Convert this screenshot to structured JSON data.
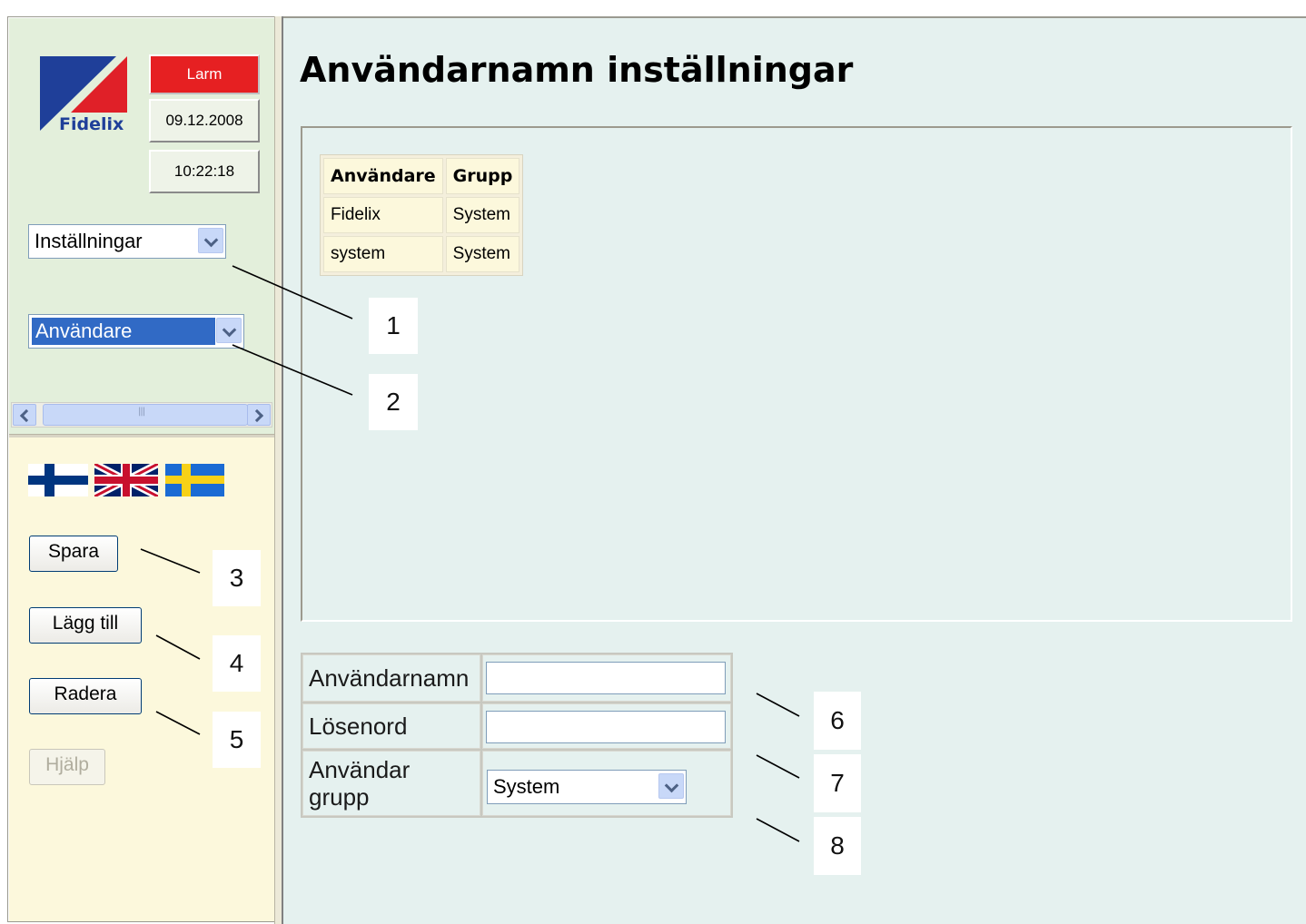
{
  "header": {
    "alarm_label": "Larm",
    "date": "09.12.2008",
    "time": "10:22:18"
  },
  "logo": {
    "text": "Fidelix",
    "colors": {
      "blue": "#1f3f99",
      "red": "#e02028"
    }
  },
  "nav": {
    "menu_select": "Inställningar",
    "submenu_select": "Användare"
  },
  "languages": [
    "finnish-flag",
    "uk-flag",
    "swedish-flag"
  ],
  "actions": {
    "save": "Spara",
    "add": "Lägg till",
    "delete": "Radera",
    "help": "Hjälp"
  },
  "page": {
    "title": "Användarnamn inställningar"
  },
  "users_table": {
    "headers": [
      "Användare",
      "Grupp"
    ],
    "rows": [
      [
        "Fidelix",
        "System"
      ],
      [
        "system",
        "System"
      ]
    ]
  },
  "form": {
    "username_label": "Användarnamn",
    "username_value": "",
    "password_label": "Lösenord",
    "password_value": "",
    "group_label_line1": "Användar",
    "group_label_line2": "grupp",
    "group_value": "System"
  },
  "callouts": [
    "1",
    "2",
    "3",
    "4",
    "5",
    "6",
    "7",
    "8"
  ],
  "colors": {
    "alarm_bg": "#e62022",
    "nav_bg": "#e3efdb",
    "actions_bg": "#fcf8dc",
    "content_bg": "#e5f1ef",
    "selection": "#316ac5"
  }
}
